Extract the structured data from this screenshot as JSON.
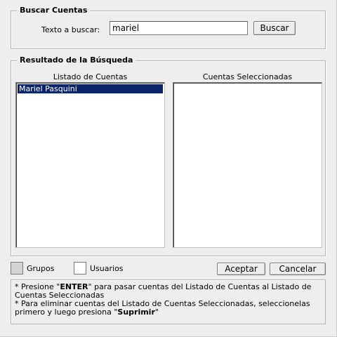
{
  "search": {
    "legend": "Buscar Cuentas",
    "label": "Texto a buscar:",
    "value": "mariel",
    "button_label": "Buscar"
  },
  "results": {
    "legend": "Resultado de la Búsqueda",
    "left_header": "Listado de Cuentas",
    "right_header": "Cuentas Seleccionadas",
    "left_items": [
      {
        "label": "Mariel Pasquini",
        "selected": true
      }
    ],
    "right_items": []
  },
  "filters": {
    "grupos_label": "Grupos",
    "usuarios_label": "Usuarios"
  },
  "actions": {
    "accept_label": "Aceptar",
    "cancel_label": "Cancelar"
  },
  "notes": {
    "line1_prefix": "* Presione \"",
    "line1_key": "ENTER",
    "line1_suffix": "\" para pasar cuentas del Listado de Cuentas al Listado de Cuentas Seleccionadas",
    "line2_prefix": "* Para eliminar cuentas del Listado de Cuentas Seleccionadas, seleccionelas primero y luego presiona \"",
    "line2_key": "Suprimir",
    "line2_suffix": "\""
  },
  "colors": {
    "selection_bg": "#0a246a",
    "selection_fg": "#ffffff",
    "window_bg": "#eeeeee"
  }
}
